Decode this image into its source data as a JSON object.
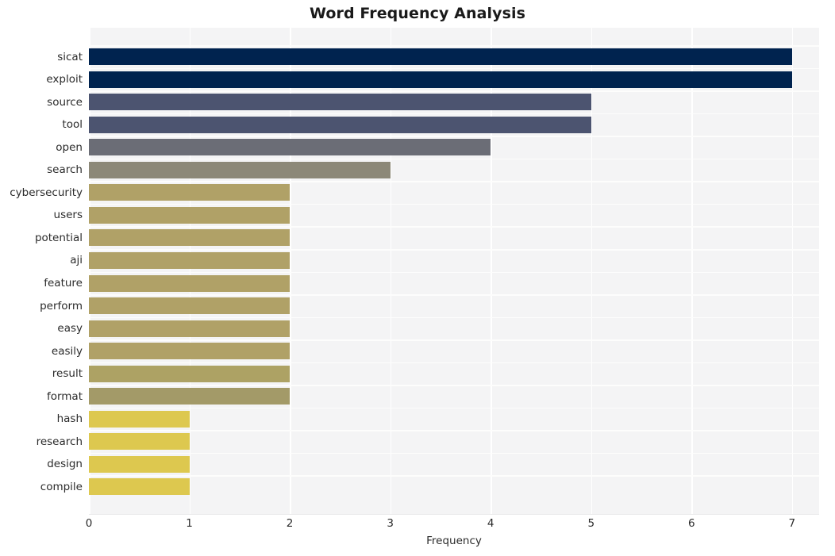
{
  "chart_data": {
    "type": "bar",
    "orientation": "horizontal",
    "title": "Word Frequency Analysis",
    "xlabel": "Frequency",
    "ylabel": "",
    "xlim": [
      0,
      7.27
    ],
    "xticks": [
      0,
      1,
      2,
      3,
      4,
      5,
      6,
      7
    ],
    "xtick_labels": [
      "0",
      "1",
      "2",
      "3",
      "4",
      "5",
      "6",
      "7"
    ],
    "grid": true,
    "grid_color": "#ffffff",
    "plot_background": "#f4f4f5",
    "figure_background": "#ffffff",
    "legend": null,
    "categories": [
      "sicat",
      "exploit",
      "source",
      "tool",
      "open",
      "search",
      "cybersecurity",
      "users",
      "potential",
      "aji",
      "feature",
      "perform",
      "easy",
      "easily",
      "result",
      "format",
      "hash",
      "research",
      "design",
      "compile"
    ],
    "values": [
      7,
      7,
      5,
      5,
      4,
      3,
      2,
      2,
      2,
      2,
      2,
      2,
      2,
      2,
      2,
      2,
      1,
      1,
      1,
      1
    ],
    "bar_colors": [
      "#00234f",
      "#00234f",
      "#4c5470",
      "#4c5470",
      "#6b6d76",
      "#8c8878",
      "#b0a167",
      "#b0a167",
      "#b0a167",
      "#b0a167",
      "#b0a167",
      "#b0a167",
      "#b0a167",
      "#b0a167",
      "#ada264",
      "#a39a68",
      "#ddc84f",
      "#ddc84f",
      "#ddc84f",
      "#ddc84f"
    ],
    "colormap": "cividis"
  }
}
